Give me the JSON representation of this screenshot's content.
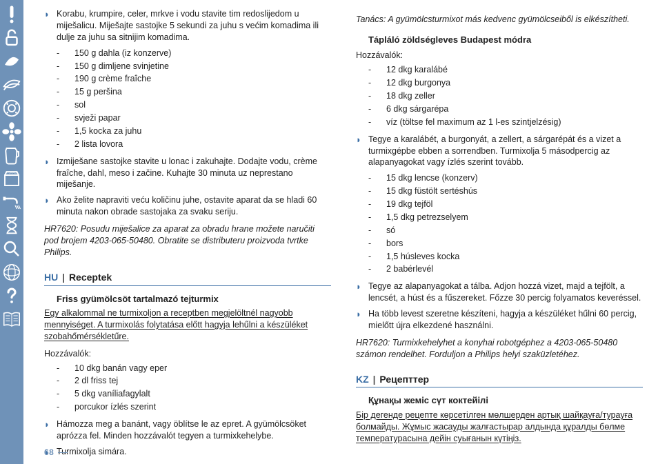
{
  "pageNumber": "68",
  "col1": {
    "intro_step": "Korabu, krumpire, celer, mrkve i vodu stavite tim redoslijedom u miješalicu. Miješajte sastojke 5 sekundi za juhu s većim komadima ili dulje za juhu sa sitnijim komadima.",
    "ing1": [
      "150 g dahla (iz konzerve)",
      "150 g dimljene svinjetine",
      "190 g crème fraîche",
      "15 g peršina",
      "sol",
      "svježi papar",
      "1,5 kocka za juhu",
      "2 lista lovora"
    ],
    "step2": "Izmiješane sastojke stavite u lonac i zakuhajte. Dodajte vodu, crème fraîche, dahl, meso i začine. Kuhajte 30 minuta uz neprestano miješanje.",
    "step3": "Ako želite napraviti veću količinu juhe, ostavite aparat da se hladi 60 minuta nakon obrade sastojaka za svaku seriju.",
    "note1": "HR7620: Posudu miješalice za aparat za obradu hrane možete naručiti pod brojem 4203-065-50480. Obratite se distributeru proizvoda tvrtke Philips.",
    "hu_lang": "HU",
    "hu_bar": "|",
    "hu_title": "Receptek",
    "hu_r1_title": "Friss gyümölcsöt tartalmazó tejturmix",
    "hu_warn": "Egy alkalommal ne turmixoljon a receptben megjelöltnél nagyobb mennyiséget. A turmixolás folytatása előtt hagyja lehűlni a készüléket szobahőmérsékletűre.",
    "hu_hozz": "Hozzávalók:",
    "hu_ing": [
      "10 dkg banán vagy eper",
      "2 dl friss tej",
      "5 dkg vaníliafagylalt",
      "porcukor ízlés szerint"
    ],
    "hu_step1": "Hámozza meg a banánt, vagy öblítse le az epret. A gyümölcsöket aprózza fel. Minden hozzávalót tegyen a turmixkehelybe.",
    "hu_step2": "Turmixolja simára."
  },
  "col2": {
    "tip": "Tanács: A gyümölcsturmixot más kedvenc gyümölcseiből is elkészítheti.",
    "r2_title": "Tápláló zöldségleves Budapest módra",
    "hozz": "Hozzávalók:",
    "ing1": [
      "12 dkg karalábé",
      "12 dkg burgonya",
      "18 dkg zeller",
      "6 dkg sárgarépa",
      "víz (töltse fel maximum az 1 l-es szintjelzésig)"
    ],
    "step1": "Tegye a karalábét, a burgonyát, a zellert, a sárgarépát és a vizet a turmixgépbe ebben a sorrendben. Turmixolja 5 másodpercig az alapanyagokat vagy ízlés szerint tovább.",
    "ing2": [
      "15 dkg lencse (konzerv)",
      "15 dkg füstölt sertéshús",
      "19 dkg tejföl",
      "1,5 dkg petrezselyem",
      "só",
      "bors",
      "1,5 húsleves kocka",
      "2 babérlevél"
    ],
    "step2": "Tegye az alapanyagokat a tálba. Adjon hozzá vizet, majd a tejfölt, a lencsét, a húst és a fűszereket. Főzze 30 percig folyamatos keveréssel.",
    "step3": "Ha több levest szeretne készíteni, hagyja a készüléket hűlni 60 percig, mielőtt újra elkezdené használni.",
    "note": "HR7620: Turmixkehelyhet a konyhai robotgéphez a 4203-065-50480 számon rendelhet. Forduljon a Philips helyi szaküzletéhez.",
    "kz_lang": "KZ",
    "kz_bar": "|",
    "kz_title": "Рецепттер",
    "kz_r1_title": "Құнақы жеміс сүт коктейілі",
    "kz_warn": "Бір дегенде рецепте көрсетілген мөлшерден артық шайқауға/турауға болмайды. Жұмыс жасауды жалғастырар алдында құралды бөлме температурасына дейін суығанын күтіңіз."
  },
  "icons": [
    "exclaim",
    "lock",
    "leaf",
    "leaf2",
    "washer",
    "fan",
    "jug",
    "storage-box",
    "tap",
    "hourglass",
    "magnify",
    "globe",
    "question",
    "book"
  ]
}
